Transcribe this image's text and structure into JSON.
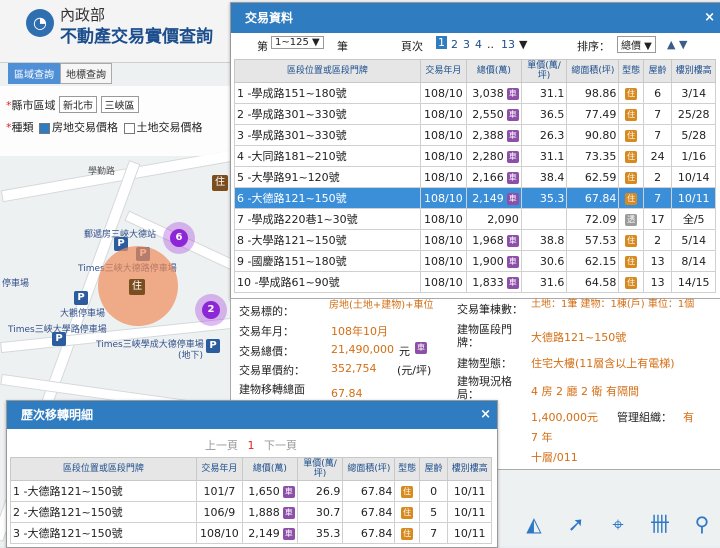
{
  "brand": {
    "line1": "內政部",
    "line2": "不動產交易實價查詢",
    "logo_glyph": "◔"
  },
  "tabs": [
    "區域查詢",
    "地標查詢"
  ],
  "filters": {
    "district_label": "縣市區域",
    "city": "新北市",
    "town": "三峽區",
    "type_label": "種類",
    "opt1": "房地交易價格",
    "opt2": "土地交易價格"
  },
  "map": {
    "labels": [
      "郵遞房三峽大德站",
      "Times三峽大德路停車場",
      "大觀停車場",
      "Times三峽大學路停車場",
      "Times三峽學成大德停車場",
      "(地下)",
      "停車場",
      "學勤路"
    ],
    "cluster1": "6",
    "cluster2": "2",
    "pin": "P",
    "house": "住"
  },
  "trade": {
    "title": "交易資料",
    "close": "×",
    "page_prefix": "第",
    "page_range": "1~125 ▼",
    "page_suffix": "筆",
    "pager_label": "頁次",
    "pager": [
      "1",
      "2",
      "3",
      "4",
      "..",
      "13",
      "▼"
    ],
    "sort_label": "排序：",
    "sort_value": "總價 ▼",
    "sort_arrows": "▲ ▼",
    "headers": [
      "區段位置或區段門牌",
      "交易年月",
      "總價(萬)",
      "單價(萬/坪)",
      "總面積(坪)",
      "型態",
      "屋齡",
      "樓別樓高"
    ],
    "rows": [
      {
        "addr": "1 -學成路151~180號",
        "ym": "108/10",
        "total": "3,038",
        "unit": "31.1",
        "area": "98.86",
        "type": "住",
        "age": "6",
        "floor": "3/14"
      },
      {
        "addr": "2 -學成路301~330號",
        "ym": "108/10",
        "total": "2,550",
        "unit": "36.5",
        "area": "77.49",
        "type": "住",
        "age": "7",
        "floor": "25/28"
      },
      {
        "addr": "3 -學成路301~330號",
        "ym": "108/10",
        "total": "2,388",
        "unit": "26.3",
        "area": "90.80",
        "type": "住",
        "age": "7",
        "floor": "5/28"
      },
      {
        "addr": "4 -大同路181~210號",
        "ym": "108/10",
        "total": "2,280",
        "unit": "31.1",
        "area": "73.35",
        "type": "住",
        "age": "24",
        "floor": "1/16"
      },
      {
        "addr": "5 -大學路91~120號",
        "ym": "108/10",
        "total": "2,166",
        "unit": "38.4",
        "area": "62.59",
        "type": "住",
        "age": "2",
        "floor": "10/14"
      },
      {
        "addr": "6 -大德路121~150號",
        "ym": "108/10",
        "total": "2,149",
        "unit": "35.3",
        "area": "67.84",
        "type": "住",
        "age": "7",
        "floor": "10/11"
      },
      {
        "addr": "7 -學成路220巷1~30號",
        "ym": "108/10",
        "total": "2,090",
        "unit": "",
        "area": "72.09",
        "type": "透",
        "age": "17",
        "floor": "全/5"
      },
      {
        "addr": "8 -大學路121~150號",
        "ym": "108/10",
        "total": "1,968",
        "unit": "38.8",
        "area": "57.53",
        "type": "住",
        "age": "2",
        "floor": "5/14"
      },
      {
        "addr": "9 -國慶路151~180號",
        "ym": "108/10",
        "total": "1,900",
        "unit": "30.6",
        "area": "62.15",
        "type": "住",
        "age": "13",
        "floor": "8/14"
      },
      {
        "addr": "10 -學成路61~90號",
        "ym": "108/10",
        "total": "1,833",
        "unit": "31.6",
        "area": "64.58",
        "type": "住",
        "age": "13",
        "floor": "14/15"
      }
    ],
    "car_tag": "車"
  },
  "detail": {
    "target_label": "交易標的：",
    "target_value": "房地(土地+建物)+車位",
    "ym_label": "交易年月：",
    "ym_value": "108年10月",
    "total_label": "交易總價：",
    "total_value": "21,490,000",
    "total_unit": "元",
    "unit_label": "交易單價約：",
    "unit_value": "352,754",
    "unit_unit": "(元/坪)",
    "area_label": "建物移轉總面",
    "area_value": "67.84",
    "count_label": "交易筆棟數：",
    "count_value": "土地：1筆 建物：1棟(戶) 車位：1個",
    "addr_label": "建物區段門牌：",
    "addr_value": "大德路121~150號",
    "btype_label": "建物型態：",
    "btype_value": "住宅大樓(11層含以上有電梯)",
    "layout_label": "建物現況格局：",
    "layout_value": "4 房 2 廳 2 衛 有隔間",
    "price_value": "1,400,000元",
    "mgmt_label": "管理組織：",
    "mgmt_value": "有",
    "years_value": "7 年",
    "floor_value": "十層/011"
  },
  "history": {
    "title": "歷次移轉明細",
    "close": "×",
    "prev": "上一頁",
    "page": "1",
    "next": "下一頁",
    "headers": [
      "區段位置或區段門牌",
      "交易年月",
      "總價(萬)",
      "單價(萬/坪)",
      "總面積(坪)",
      "型態",
      "屋齡",
      "樓別樓高"
    ],
    "rows": [
      {
        "addr": "1 -大德路121~150號",
        "ym": "101/7",
        "total": "1,650",
        "unit": "26.9",
        "area": "67.84",
        "type": "住",
        "age": "0",
        "floor": "10/11"
      },
      {
        "addr": "2 -大德路121~150號",
        "ym": "106/9",
        "total": "1,888",
        "unit": "30.7",
        "area": "67.84",
        "type": "住",
        "age": "5",
        "floor": "10/11"
      },
      {
        "addr": "3 -大德路121~150號",
        "ym": "108/10",
        "total": "2,149",
        "unit": "35.3",
        "area": "67.84",
        "type": "住",
        "age": "7",
        "floor": "10/11"
      }
    ]
  },
  "icons": [
    "measure-icon",
    "pointer-icon",
    "locate-icon",
    "layers-icon",
    "pin-icon"
  ],
  "colors": {
    "accent": "#2f7cc0",
    "highlight": "#3b8fd9",
    "value": "#d46e14",
    "car_tag": "#8d4fa8",
    "house_tag": "#d68a1f"
  }
}
